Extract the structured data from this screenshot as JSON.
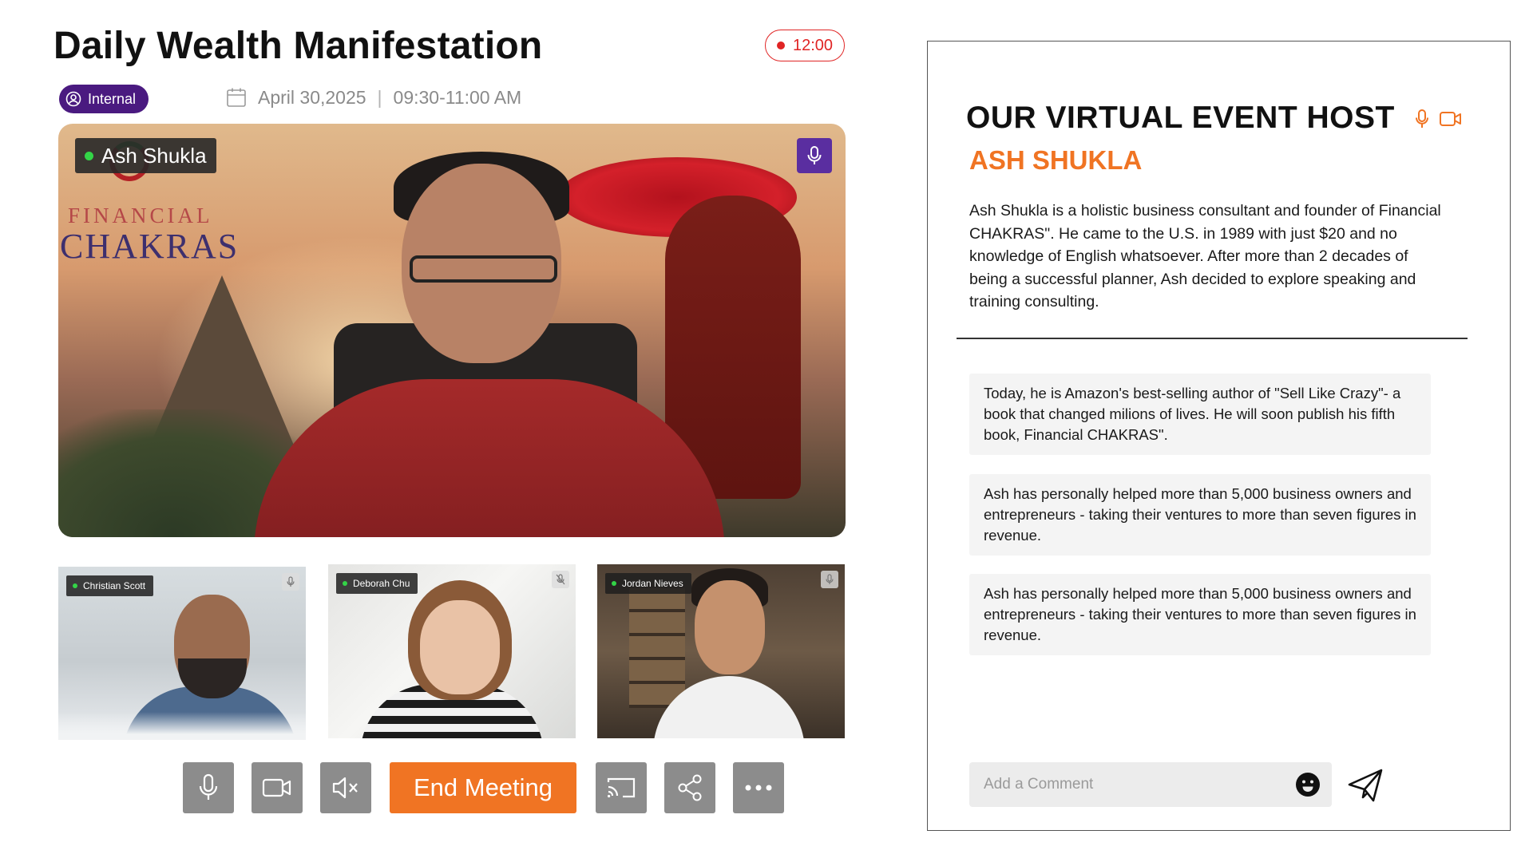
{
  "meeting": {
    "title": "Daily Wealth Manifestation",
    "timer": "12:00",
    "badge": "Internal",
    "date": "April 30,2025",
    "time": "09:30-11:00 AM",
    "separator": "|"
  },
  "main_video": {
    "speaker": "Ash Shukla",
    "logo_line1": "FINANCIAL",
    "logo_line2": "CHAKRAS"
  },
  "participants": [
    {
      "name": "Christian Scott"
    },
    {
      "name": "Deborah Chu"
    },
    {
      "name": "Jordan Nieves"
    }
  ],
  "controls": {
    "end_meeting_label": "End Meeting",
    "icons": [
      "mic-icon",
      "camera-icon",
      "speaker-mute-icon",
      "cast-icon",
      "share-icon",
      "more-icon"
    ]
  },
  "host_panel": {
    "heading": "OUR VIRTUAL EVENT HOST",
    "name": "ASH SHUKLA",
    "bio": "Ash Shukla is a holistic business consultant and founder of Financial CHAKRAS\". He came to the U.S. in 1989 with just $20 and no knowledge of English whatsoever. After more than 2 decades of being a successful planner, Ash decided to explore speaking and training consulting.",
    "cards": [
      "Today, he is Amazon's best-selling author of \"Sell Like Crazy\"- a book that changed milions of lives. He will soon publish his fifth book, Financial CHAKRAS\".",
      "Ash has personally helped more than 5,000 business owners and entrepreneurs - taking their ventures to more than seven figures in revenue.",
      "Ash has personally helped more than 5,000 business owners and entrepreneurs - taking their ventures to more than seven figures in revenue."
    ],
    "comment_placeholder": "Add a Comment"
  },
  "colors": {
    "accent": "#f07423",
    "badge_purple": "#4a1a80",
    "mic_purple": "#5a2ea0",
    "record_red": "#e02424",
    "control_gray": "#8c8c8c"
  }
}
